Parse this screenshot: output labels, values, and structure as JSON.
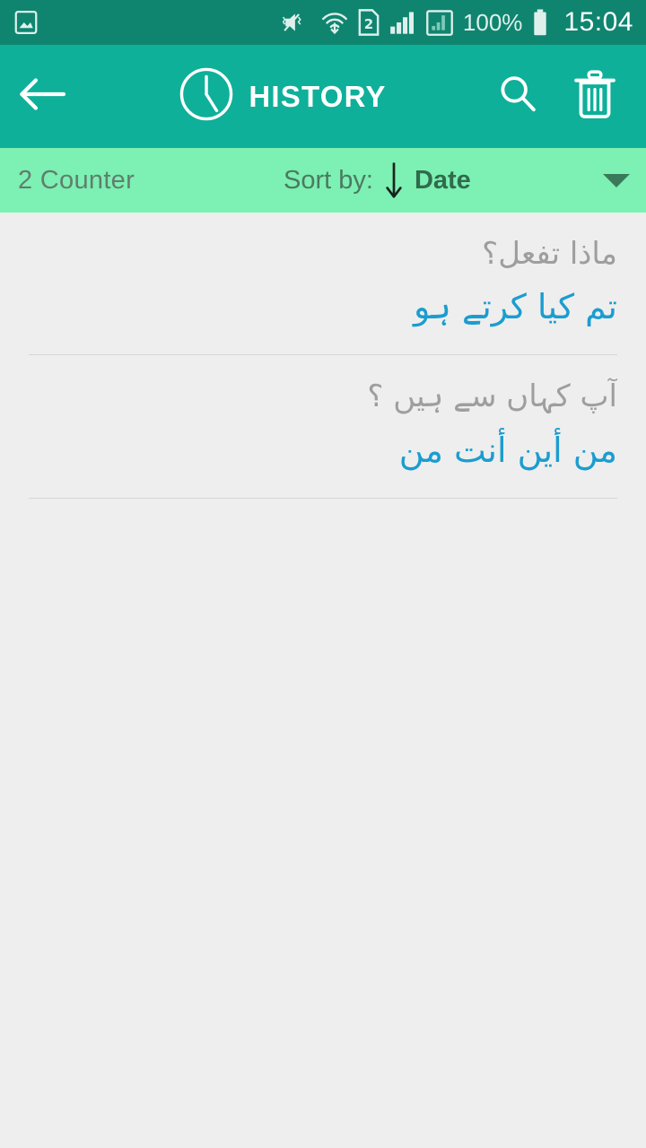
{
  "statusbar": {
    "icons_left": [
      "screenshot-gallery-icon"
    ],
    "icons_right": [
      "mute-vibrate-icon",
      "wifi-icon",
      "sim2-icon",
      "signal-bars-icon",
      "signal-second-icon"
    ],
    "battery_percent": "100%",
    "battery_icon": "battery-full-icon",
    "time": "15:04",
    "bg_color": "#0f8570"
  },
  "appbar": {
    "back_icon": "back-arrow-icon",
    "clock_icon": "clock-icon",
    "title": "HISTORY",
    "search_icon": "search-icon",
    "delete_icon": "trash-icon",
    "bg_color": "#0eb09a"
  },
  "sortbar": {
    "counter": "2 Counter",
    "sort_label": "Sort by:",
    "direction_icon": "arrow-down-icon",
    "sort_value": "Date",
    "caret_icon": "chevron-down-icon",
    "bg_color": "#7df0b4"
  },
  "list": {
    "items": [
      {
        "source_text": "ماذا تفعل؟",
        "translated_text": "تم کیا کرتے ہو"
      },
      {
        "source_text": "آپ کہاں سے ہیں ؟",
        "translated_text": "من أين أنت من"
      }
    ]
  },
  "colors": {
    "accent_blue": "#1b9dd0",
    "muted_gray": "#9e9e9e",
    "page_bg": "#eeeeee"
  }
}
